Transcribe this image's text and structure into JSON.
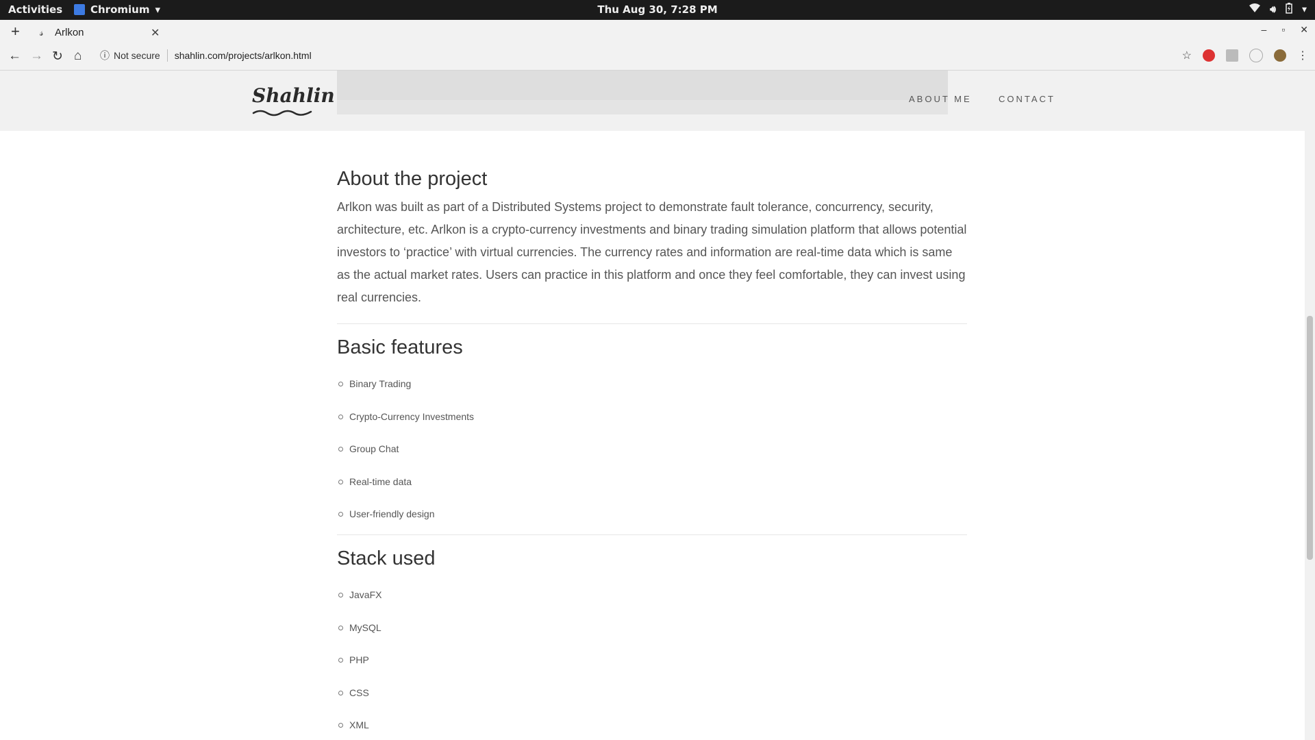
{
  "system_bar": {
    "activities": "Activities",
    "app_name": "Chromium",
    "clock": "Thu Aug 30,  7:28 PM"
  },
  "browser": {
    "tab_title": "Arlkon",
    "security_label": "Not secure",
    "url": "shahlin.com/projects/arlkon.html"
  },
  "site": {
    "logo": "Shahlin",
    "nav": [
      "ABOUT ME",
      "CONTACT"
    ],
    "sections": {
      "about": {
        "heading": "About the project",
        "body": "Arlkon was built as part of a Distributed Systems project to demonstrate fault tolerance, concurrency, security, architecture, etc. Arlkon is a crypto-currency investments and binary trading simulation platform that allows potential investors to ‘practice’ with virtual currencies. The currency rates and information are real-time data which is same as the actual market rates. Users can practice in this platform and once they feel comfortable, they can invest using real currencies."
      },
      "features": {
        "heading": "Basic features",
        "items": [
          "Binary Trading",
          "Crypto-Currency Investments",
          "Group Chat",
          "Real-time data",
          "User-friendly design"
        ]
      },
      "stack": {
        "heading": "Stack used",
        "items": [
          "JavaFX",
          "MySQL",
          "PHP",
          "CSS",
          "XML"
        ]
      }
    }
  }
}
